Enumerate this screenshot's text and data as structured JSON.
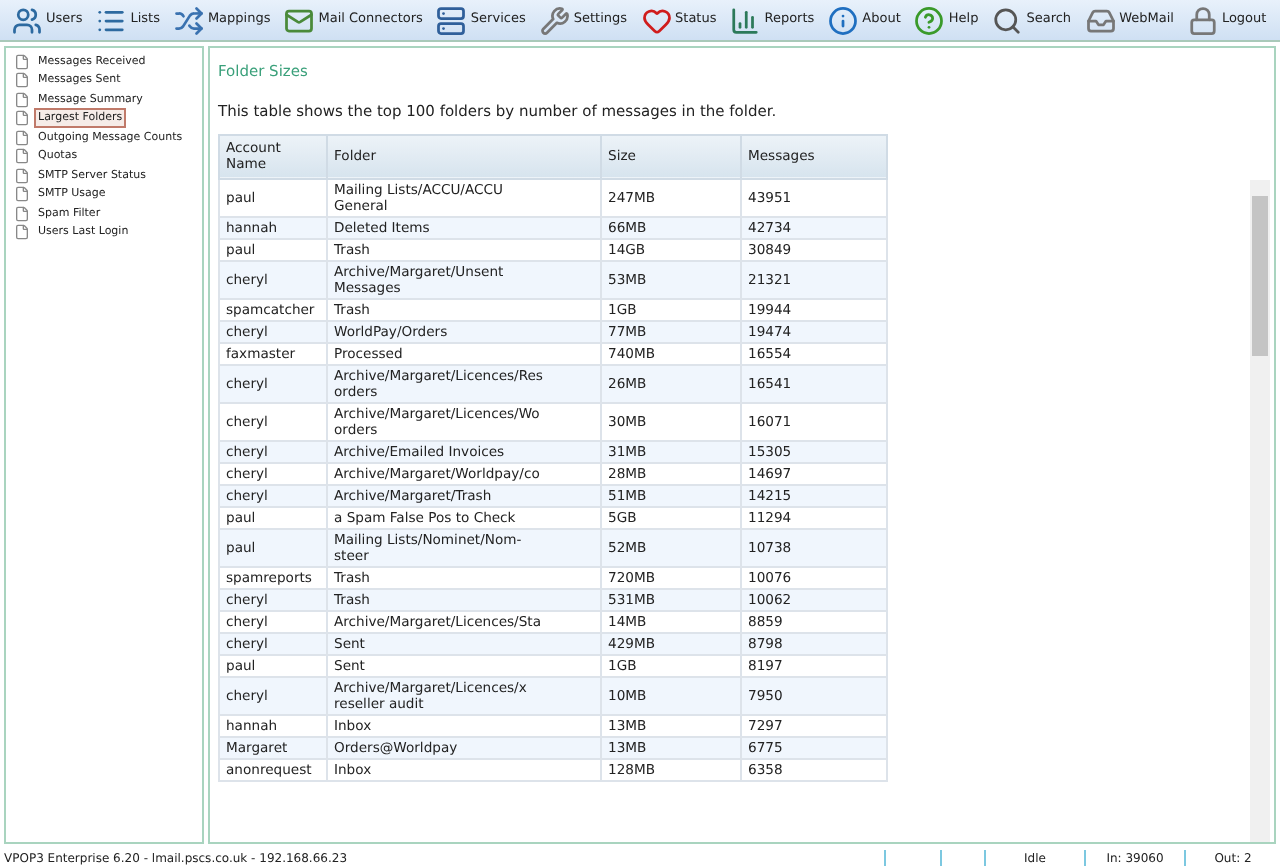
{
  "toolbar": [
    {
      "label": "Users"
    },
    {
      "label": "Lists"
    },
    {
      "label": "Mappings"
    },
    {
      "label": "Mail Connectors"
    },
    {
      "label": "Services"
    },
    {
      "label": "Settings"
    },
    {
      "label": "Status"
    },
    {
      "label": "Reports"
    },
    {
      "label": "About"
    },
    {
      "label": "Help"
    },
    {
      "label": "Search"
    },
    {
      "label": "WebMail"
    },
    {
      "label": "Logout"
    }
  ],
  "sidebar": {
    "items": [
      {
        "label": "Messages Received",
        "selected": false
      },
      {
        "label": "Messages Sent",
        "selected": false
      },
      {
        "label": "Message Summary",
        "selected": false
      },
      {
        "label": "Largest Folders",
        "selected": true
      },
      {
        "label": "Outgoing Message Counts",
        "selected": false
      },
      {
        "label": "Quotas",
        "selected": false
      },
      {
        "label": "SMTP Server Status",
        "selected": false
      },
      {
        "label": "SMTP Usage",
        "selected": false
      },
      {
        "label": "Spam Filter",
        "selected": false
      },
      {
        "label": "Users Last Login",
        "selected": false
      }
    ]
  },
  "content": {
    "title": "Folder Sizes",
    "description": "This table shows the top 100 folders by number of messages in the folder.",
    "table": {
      "columns": [
        "Account\nName",
        "Folder",
        "Size",
        "Messages"
      ],
      "rows": [
        [
          "paul",
          "Mailing Lists/ACCU/ACCU\nGeneral",
          "247MB",
          "43951"
        ],
        [
          "hannah",
          "Deleted Items",
          "66MB",
          "42734"
        ],
        [
          "paul",
          "Trash",
          "14GB",
          "30849"
        ],
        [
          "cheryl",
          "Archive/Margaret/Unsent\nMessages",
          "53MB",
          "21321"
        ],
        [
          "spamcatcher",
          "Trash",
          "1GB",
          "19944"
        ],
        [
          "cheryl",
          "WorldPay/Orders",
          "77MB",
          "19474"
        ],
        [
          "faxmaster",
          "Processed",
          "740MB",
          "16554"
        ],
        [
          "cheryl",
          "Archive/Margaret/Licences/Res\norders",
          "26MB",
          "16541"
        ],
        [
          "cheryl",
          "Archive/Margaret/Licences/Wo\norders",
          "30MB",
          "16071"
        ],
        [
          "cheryl",
          "Archive/Emailed Invoices",
          "31MB",
          "15305"
        ],
        [
          "cheryl",
          "Archive/Margaret/Worldpay/co",
          "28MB",
          "14697"
        ],
        [
          "cheryl",
          "Archive/Margaret/Trash",
          "51MB",
          "14215"
        ],
        [
          "paul",
          "a Spam False Pos to Check",
          "5GB",
          "11294"
        ],
        [
          "paul",
          "Mailing Lists/Nominet/Nom-\nsteer",
          "52MB",
          "10738"
        ],
        [
          "spamreports",
          "Trash",
          "720MB",
          "10076"
        ],
        [
          "cheryl",
          "Trash",
          "531MB",
          "10062"
        ],
        [
          "cheryl",
          "Archive/Margaret/Licences/Sta",
          "14MB",
          "8859"
        ],
        [
          "cheryl",
          "Sent",
          "429MB",
          "8798"
        ],
        [
          "paul",
          "Sent",
          "1GB",
          "8197"
        ],
        [
          "cheryl",
          "Archive/Margaret/Licences/x\nreseller audit",
          "10MB",
          "7950"
        ],
        [
          "hannah",
          "Inbox",
          "13MB",
          "7297"
        ],
        [
          "Margaret",
          "Orders@Worldpay",
          "13MB",
          "6775"
        ],
        [
          "anonrequest",
          "Inbox",
          "128MB",
          "6358"
        ]
      ]
    }
  },
  "status_bar": {
    "server": "VPOP3 Enterprise 6.20 - lmail.pscs.co.uk - 192.168.66.23",
    "state": "Idle",
    "in": "In: 39060",
    "out": "Out: 2"
  }
}
